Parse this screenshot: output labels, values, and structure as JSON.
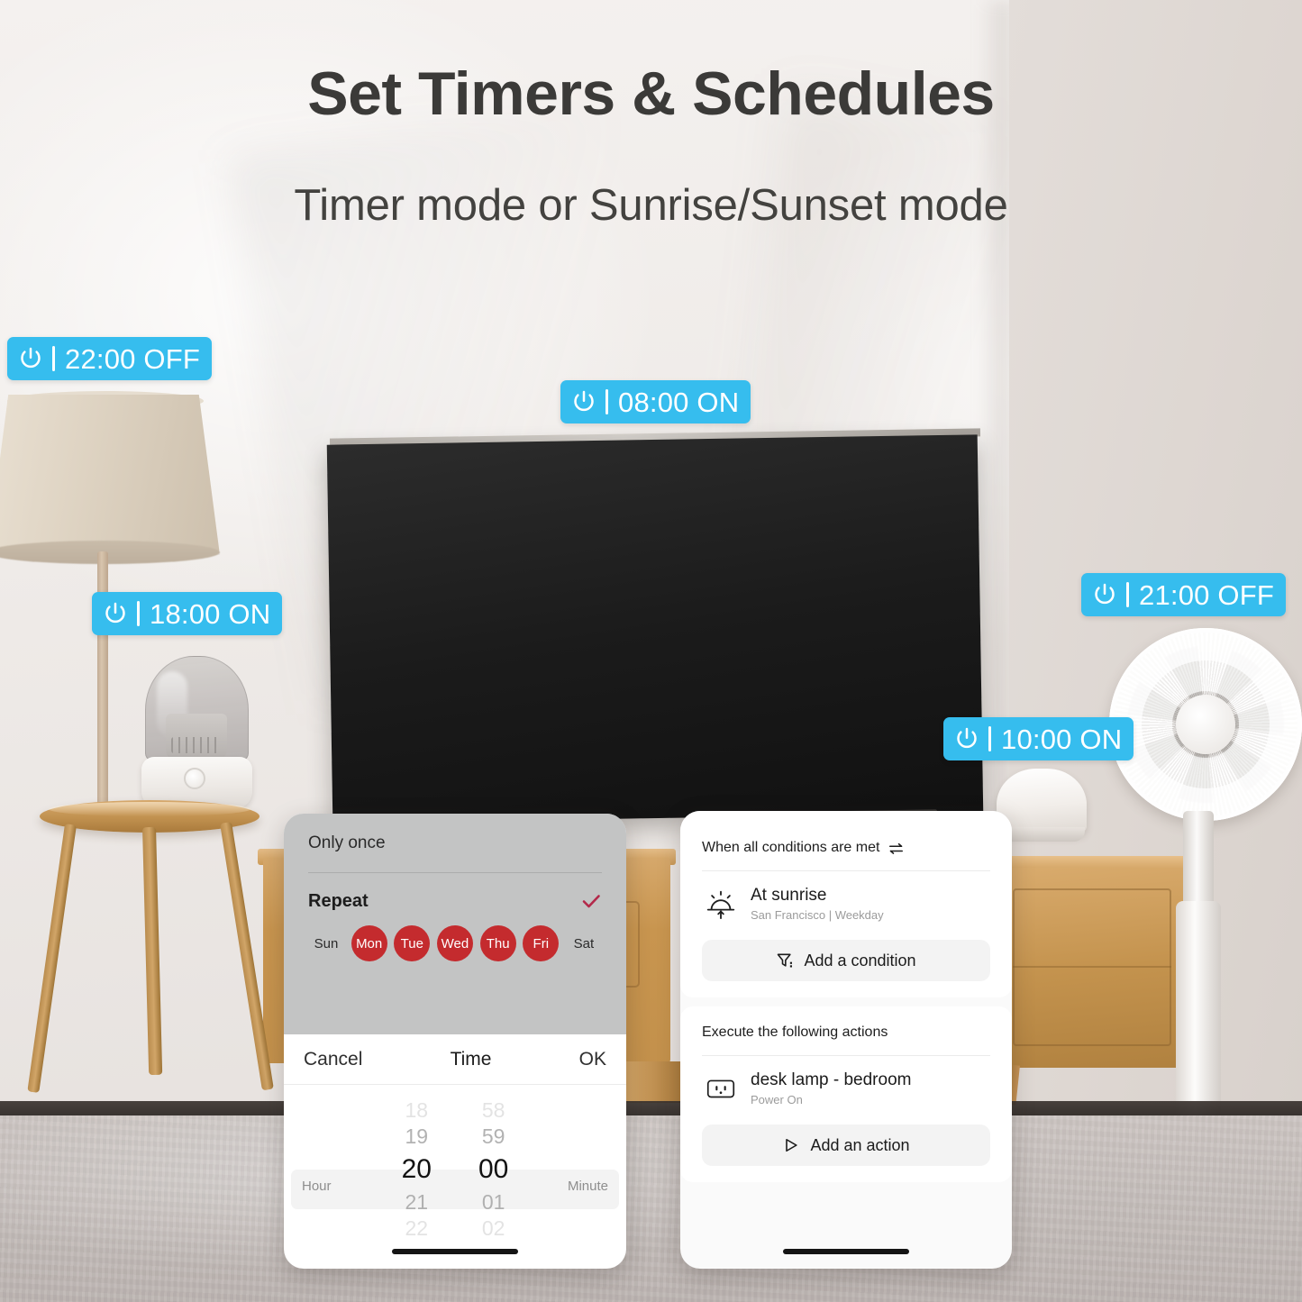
{
  "headings": {
    "title": "Set Timers & Schedules",
    "subtitle": "Timer mode or Sunrise/Sunset mode"
  },
  "theme": {
    "badge_bg": "#36bdee",
    "badge_text": "#ffffff",
    "day_selected_bg": "#c42b2e",
    "check_color": "#b3294a"
  },
  "badges": [
    {
      "id": "2200off",
      "icon": "power-icon",
      "time": "22:00",
      "state": "OFF",
      "label": "22:00 OFF"
    },
    {
      "id": "0800on",
      "icon": "power-icon",
      "time": "08:00",
      "state": "ON",
      "label": "08:00 ON"
    },
    {
      "id": "1800on",
      "icon": "power-icon",
      "time": "18:00",
      "state": "ON",
      "label": "18:00 ON"
    },
    {
      "id": "2100off",
      "icon": "power-icon",
      "time": "21:00",
      "state": "OFF",
      "label": "21:00 OFF"
    },
    {
      "id": "1000on",
      "icon": "power-icon",
      "time": "10:00",
      "state": "ON",
      "label": "10:00 ON"
    }
  ],
  "left_panel": {
    "only_once_label": "Only once",
    "repeat_label": "Repeat",
    "repeat_checked_icon": "check-icon",
    "days": [
      {
        "label": "Sun",
        "selected": false
      },
      {
        "label": "Mon",
        "selected": true
      },
      {
        "label": "Tue",
        "selected": true
      },
      {
        "label": "Wed",
        "selected": true
      },
      {
        "label": "Thu",
        "selected": true
      },
      {
        "label": "Fri",
        "selected": true
      },
      {
        "label": "Sat",
        "selected": false
      }
    ],
    "time_picker": {
      "cancel_label": "Cancel",
      "title": "Time",
      "ok_label": "OK",
      "hour_label": "Hour",
      "minute_label": "Minute",
      "hours": [
        "18",
        "19",
        "20",
        "21",
        "22"
      ],
      "minutes": [
        "58",
        "59",
        "00",
        "01",
        "02"
      ],
      "selected_hour": "20",
      "selected_minute": "00"
    }
  },
  "right_panel": {
    "conditions": {
      "header": "When all conditions are met",
      "header_icon": "swap-icon",
      "item": {
        "icon": "sunrise-icon",
        "title": "At sunrise",
        "subtitle": "San Francisco | Weekday"
      },
      "add_button": {
        "icon": "filter-icon",
        "label": "Add a condition"
      }
    },
    "actions": {
      "header": "Execute the following actions",
      "item": {
        "icon": "outlet-icon",
        "title": "desk lamp - bedroom",
        "subtitle": "Power On"
      },
      "add_button": {
        "icon": "play-outline-icon",
        "label": "Add an action"
      }
    }
  }
}
